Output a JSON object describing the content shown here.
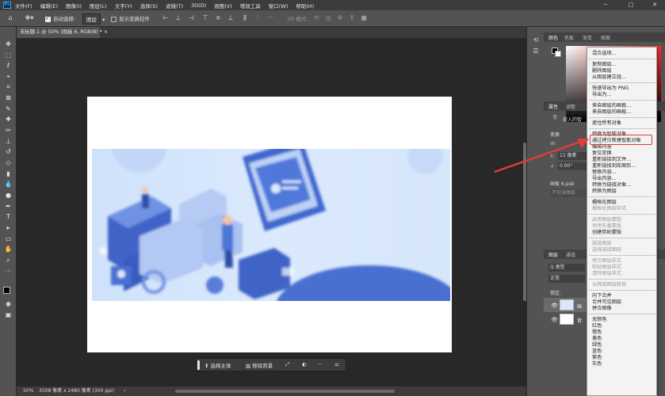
{
  "menubar": {
    "logo": "Ps",
    "items": [
      "文件(F)",
      "编辑(E)",
      "图像(I)",
      "图层(L)",
      "文字(Y)",
      "选择(S)",
      "滤镜(T)",
      "3D(D)",
      "视图(V)",
      "增效工具",
      "窗口(W)",
      "帮助(H)"
    ]
  },
  "window_controls": [
    "─",
    "□",
    "✕"
  ],
  "options": {
    "auto_select_label": "自动选择:",
    "auto_select_value": "图层",
    "show_transform_label": "显示变换控件",
    "mode_3d_label": "3D 模式:",
    "more": "···"
  },
  "document": {
    "tab_title": "未标题-1 @ 50% (画板 6, RGB/8) *",
    "tab_close": "×"
  },
  "taskbar": {
    "select_subject": "选择主体",
    "remove_background": "移除背景",
    "more": "···"
  },
  "status": {
    "zoom": "50%",
    "doc_info": "3508 像素 x 2480 像素 (300 ppi)",
    "arrow": "›"
  },
  "panels": {
    "color_tabs": [
      "颜色",
      "色板",
      "渐变",
      "图案"
    ],
    "properties_tabs": [
      "属性",
      "调整"
    ],
    "properties_content": [
      "嵌入的智",
      "变换",
      "W:",
      "H:",
      "X:",
      "Y:",
      "11 像素",
      "0.00°",
      "画板 6.psb",
      "不包含图层"
    ],
    "layers_tabs": [
      "图层",
      "通道"
    ],
    "layer_filter": "Q 类型",
    "blend_mode": "正常",
    "lock_label": "锁定:",
    "layer_names": [
      "画",
      "背"
    ]
  },
  "context_menu": {
    "groups": [
      [
        {
          "t": "混合选项...",
          "d": false
        }
      ],
      [
        {
          "t": "复制图层...",
          "d": false
        },
        {
          "t": "删除图层",
          "d": false
        },
        {
          "t": "从图层建立组...",
          "d": false
        }
      ],
      [
        {
          "t": "快速导出为 PNG",
          "d": false
        },
        {
          "t": "导出为...",
          "d": false
        }
      ],
      [
        {
          "t": "来自图层的画板...",
          "d": false
        },
        {
          "t": "来自图层的画板...",
          "d": false
        }
      ],
      [
        {
          "t": "遮住所有对象",
          "d": false
        }
      ],
      [
        {
          "t": "转换为智能对象",
          "d": false
        },
        {
          "t": "通过拷贝新建智能对象",
          "d": false
        },
        {
          "t": "编辑内容",
          "d": false
        },
        {
          "t": "复位变换",
          "d": false
        },
        {
          "t": "重新链接到文件...",
          "d": false
        },
        {
          "t": "重新链接到库图形...",
          "d": false
        },
        {
          "t": "替换内容...",
          "d": false
        },
        {
          "t": "导出内容...",
          "d": false
        },
        {
          "t": "转换为链接对象...",
          "d": false
        },
        {
          "t": "转换为图层",
          "d": false
        }
      ],
      [
        {
          "t": "栅格化图层",
          "d": false
        },
        {
          "t": "栅格化图层样式",
          "d": true
        }
      ],
      [
        {
          "t": "启用图层蒙版",
          "d": true
        },
        {
          "t": "停用矢量蒙版",
          "d": true
        },
        {
          "t": "创建剪贴蒙版",
          "d": false
        }
      ],
      [
        {
          "t": "链接图层",
          "d": true
        },
        {
          "t": "选择链接图层",
          "d": true
        }
      ],
      [
        {
          "t": "拷贝图层样式",
          "d": true
        },
        {
          "t": "粘贴图层样式",
          "d": true
        },
        {
          "t": "清除图层样式",
          "d": true
        }
      ],
      [
        {
          "t": "从隔离图层释放",
          "d": true
        }
      ],
      [
        {
          "t": "向下合并",
          "d": false
        },
        {
          "t": "合并可见图层",
          "d": false
        },
        {
          "t": "拼合图像",
          "d": false
        }
      ],
      [
        {
          "t": "无颜色",
          "d": false
        },
        {
          "t": "红色",
          "d": false
        },
        {
          "t": "橙色",
          "d": false
        },
        {
          "t": "黄色",
          "d": false
        },
        {
          "t": "绿色",
          "d": false
        },
        {
          "t": "蓝色",
          "d": false
        },
        {
          "t": "紫色",
          "d": false
        },
        {
          "t": "灰色",
          "d": false
        }
      ]
    ],
    "highlighted_item": "转换为智能对象"
  },
  "colors": {
    "annotation_red": "#e53b3b",
    "illustration_blue": "#4a6fd1",
    "banner_bg": "#d4e5fb"
  }
}
